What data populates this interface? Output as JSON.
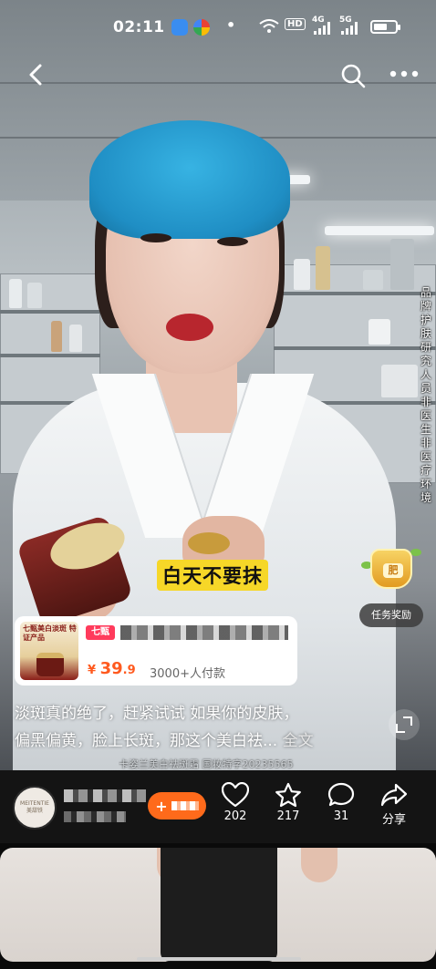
{
  "status_bar": {
    "time": "02:11",
    "network_label": "HD",
    "signal_label_1": "4G",
    "signal_label_2": "5G",
    "battery_fraction": 0.65
  },
  "top_nav": {
    "back_icon": "chevron-left-icon",
    "search_icon": "search-icon",
    "more_icon": "more-horizontal-icon"
  },
  "video": {
    "vertical_notice": "品牌护肤研究人员非医生非医疗环境",
    "caption_sticker": "白天不要抹",
    "subtitle_strip": "卡姿兰美白祛斑霜 国妆特字20235565"
  },
  "task_widget": {
    "pot_label": "肥",
    "label": "任务奖励"
  },
  "product_card": {
    "thumb_text": "七甄美白淡斑 特证产品",
    "badge": "七甄",
    "currency": "¥",
    "price_int": "39",
    "price_dec": ".9",
    "sold": "3000+人付款"
  },
  "description": {
    "line1": "淡斑真的绝了，赶紧试试 如果你的皮肤，",
    "line2": "偏黑偏黄，脸上长斑，那这个美白祛...",
    "more": "全文"
  },
  "author": {
    "avatar_text_1": "MEITENTIE",
    "avatar_text_2": "美甜铁"
  },
  "actions": [
    {
      "icon": "heart-icon",
      "count": "202"
    },
    {
      "icon": "star-icon",
      "count": "217"
    },
    {
      "icon": "comment-icon",
      "count": "31"
    },
    {
      "icon": "share-icon",
      "count": "分享"
    }
  ],
  "colors": {
    "accent_orange": "#ff6a1b",
    "price_orange": "#ff5a1f",
    "sticker_yellow": "#f6d728",
    "badge_pink": "#ff3b5c"
  }
}
